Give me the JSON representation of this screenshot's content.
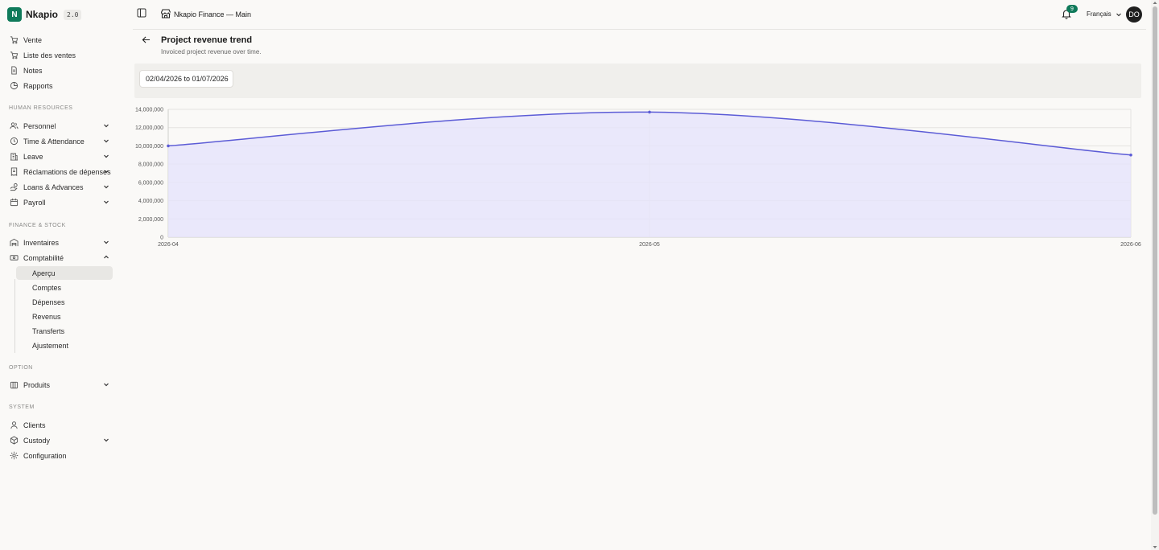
{
  "brand": {
    "name": "Nkapio",
    "version": "2.0"
  },
  "sidebar": {
    "top_items": [
      {
        "label": "Vente",
        "icon": "cart-icon"
      },
      {
        "label": "Liste des ventes",
        "icon": "cart-icon"
      },
      {
        "label": "Notes",
        "icon": "document-icon"
      },
      {
        "label": "Rapports",
        "icon": "chart-pie-icon"
      }
    ],
    "sections": [
      {
        "label": "HUMAN RESOURCES",
        "items": [
          {
            "label": "Personnel",
            "icon": "users-icon",
            "expanded": false
          },
          {
            "label": "Time & Attendance",
            "icon": "clock-icon",
            "expanded": false
          },
          {
            "label": "Leave",
            "icon": "building-icon",
            "expanded": false
          },
          {
            "label": "Réclamations de dépenses",
            "icon": "receipt-icon",
            "expanded": false
          },
          {
            "label": "Loans & Advances",
            "icon": "hand-coins-icon",
            "expanded": false
          },
          {
            "label": "Payroll",
            "icon": "calendar-icon",
            "expanded": false
          }
        ]
      },
      {
        "label": "FINANCE & STOCK",
        "items": [
          {
            "label": "Inventaires",
            "icon": "warehouse-icon",
            "expanded": false
          },
          {
            "label": "Comptabilité",
            "icon": "banknote-icon",
            "expanded": true
          }
        ]
      },
      {
        "label": "OPTION",
        "items": [
          {
            "label": "Produits",
            "icon": "package-icon",
            "expanded": false
          }
        ]
      },
      {
        "label": "SYSTEM",
        "items": [
          {
            "label": "Clients",
            "icon": "user-icon"
          },
          {
            "label": "Custody",
            "icon": "box-icon",
            "expanded": false
          },
          {
            "label": "Configuration",
            "icon": "gear-icon"
          }
        ]
      }
    ],
    "accounting_sub": [
      "Aperçu",
      "Comptes",
      "Dépenses",
      "Revenus",
      "Transferts",
      "Ajustement"
    ],
    "active_sub": "Aperçu"
  },
  "topbar": {
    "store": "Nkapio Finance — Main",
    "notifications": "9",
    "language": "Français",
    "avatar": "DO"
  },
  "page": {
    "title": "Project revenue trend",
    "subtitle": "Invoiced project revenue over time.",
    "date_range": "02/04/2026 to 01/07/2026"
  },
  "colors": {
    "accent": "#0f7a5a",
    "series": "#5b5bd6",
    "fill": "#e6e4fb"
  },
  "chart_data": {
    "type": "area",
    "categories": [
      "2026-04",
      "2026-05",
      "2026-06"
    ],
    "series": [
      {
        "values": [
          10000000,
          13700000,
          9000000
        ]
      }
    ],
    "ylim": [
      0,
      14000000
    ],
    "yticks": [
      "0",
      "2,000,000",
      "4,000,000",
      "6,000,000",
      "8,000,000",
      "10,000,000",
      "12,000,000",
      "14,000,000"
    ],
    "grid": true,
    "legend": "none"
  }
}
